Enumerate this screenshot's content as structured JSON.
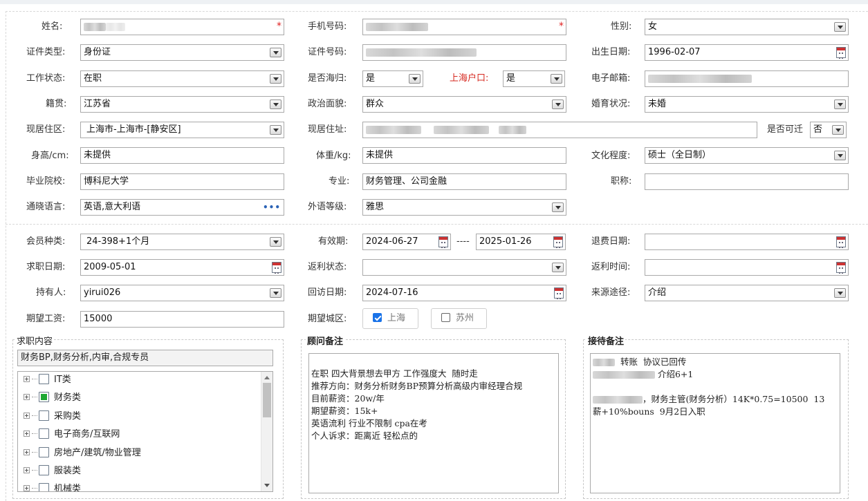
{
  "form": {
    "name": {
      "label": "姓名:",
      "value": ""
    },
    "phone": {
      "label": "手机号码:",
      "value": ""
    },
    "gender": {
      "label": "性别:",
      "value": "女"
    },
    "id_type": {
      "label": "证件类型:",
      "value": "身份证"
    },
    "id_number": {
      "label": "证件号码:",
      "value": ""
    },
    "birth_date": {
      "label": "出生日期:",
      "value": "1996-02-07"
    },
    "work_status": {
      "label": "工作状态:",
      "value": "在职"
    },
    "overseas_returnee": {
      "label": "是否海归:",
      "value": "是"
    },
    "shanghai_hukou": {
      "label": "上海户口:",
      "value": "是"
    },
    "email": {
      "label": "电子邮箱:",
      "value": ""
    },
    "native_place": {
      "label": "籍贯:",
      "value": "江苏省"
    },
    "political_status": {
      "label": "政治面貌:",
      "value": "群众"
    },
    "marital_status": {
      "label": "婚育状况:",
      "value": "未婚"
    },
    "residence_area": {
      "label": "现居住区:",
      "value": "上海市-上海市-[静安区]"
    },
    "residence_address": {
      "label": "现居住址:",
      "value": ""
    },
    "relocatable": {
      "label": "是否可迁",
      "value": "否"
    },
    "height": {
      "label": "身高/cm:",
      "value": "未提供"
    },
    "weight": {
      "label": "体重/kg:",
      "value": "未提供"
    },
    "education": {
      "label": "文化程度:",
      "value": "硕士（全日制）"
    },
    "school": {
      "label": "毕业院校:",
      "value": "博科尼大学"
    },
    "major": {
      "label": "专业:",
      "value": "财务管理、公司金融"
    },
    "title": {
      "label": "职称:",
      "value": ""
    },
    "languages": {
      "label": "通晓语言:",
      "value": "英语,意大利语"
    },
    "foreign_level": {
      "label": "外语等级:",
      "value": "雅思"
    }
  },
  "membership": {
    "member_type": {
      "label": "会员种类:",
      "value": "24-398+1个月"
    },
    "validity": {
      "label": "有效期:",
      "start": "2024-06-27",
      "separator": "----",
      "end": "2025-01-26"
    },
    "refund_date": {
      "label": "退费日期:",
      "value": ""
    },
    "job_seek_date": {
      "label": "求职日期:",
      "value": "2009-05-01"
    },
    "rebate_status": {
      "label": "返利状态:",
      "value": ""
    },
    "rebate_time": {
      "label": "返利时间:",
      "value": ""
    },
    "holder": {
      "label": "持有人:",
      "value": "yirui026"
    },
    "visit_date": {
      "label": "回访日期:",
      "value": "2024-07-16"
    },
    "source": {
      "label": "来源途径:",
      "value": "介绍"
    },
    "expected_salary": {
      "label": "期望工资:",
      "value": "15000"
    },
    "expected_city": {
      "label": "期望城区:",
      "options": [
        {
          "label": "上海",
          "checked": true
        },
        {
          "label": "苏州",
          "checked": false
        }
      ]
    }
  },
  "job_content": {
    "title": "求职内容",
    "selected": "财务BP,财务分析,内审,合规专员",
    "categories": [
      {
        "label": "IT类",
        "state": "none"
      },
      {
        "label": "财务类",
        "state": "partial"
      },
      {
        "label": "采购类",
        "state": "none"
      },
      {
        "label": "电子商务/互联网",
        "state": "none"
      },
      {
        "label": "房地产/建筑/物业管理",
        "state": "none"
      },
      {
        "label": "服装类",
        "state": "none"
      },
      {
        "label": "机械类",
        "state": "none"
      }
    ]
  },
  "consultant_notes": {
    "title": "顾问备注",
    "lines": [
      "",
      "在职 四大背景想去甲方 工作强度大  随时走",
      "推荐方向：财务分析财务BP预算分析高级内审经理合规",
      "目前薪资：20w/年",
      "期望薪资：15k+",
      "英语流利 行业不限制 cpa在考",
      "个人诉求：距离近 轻松点的"
    ]
  },
  "reception_notes": {
    "title": "接待备注",
    "lines": [
      "转账  协议已回传",
      "介绍6+1",
      "",
      "，财务主管(财务分析）14K*0.75=10500  13",
      "薪+10%bouns  9月2日入职"
    ]
  },
  "colors": {
    "hukou_label": "#d6281f",
    "required_star": "#e02020",
    "checkbox_checked": "#1a73e8",
    "partial_check": "#1fa833"
  }
}
